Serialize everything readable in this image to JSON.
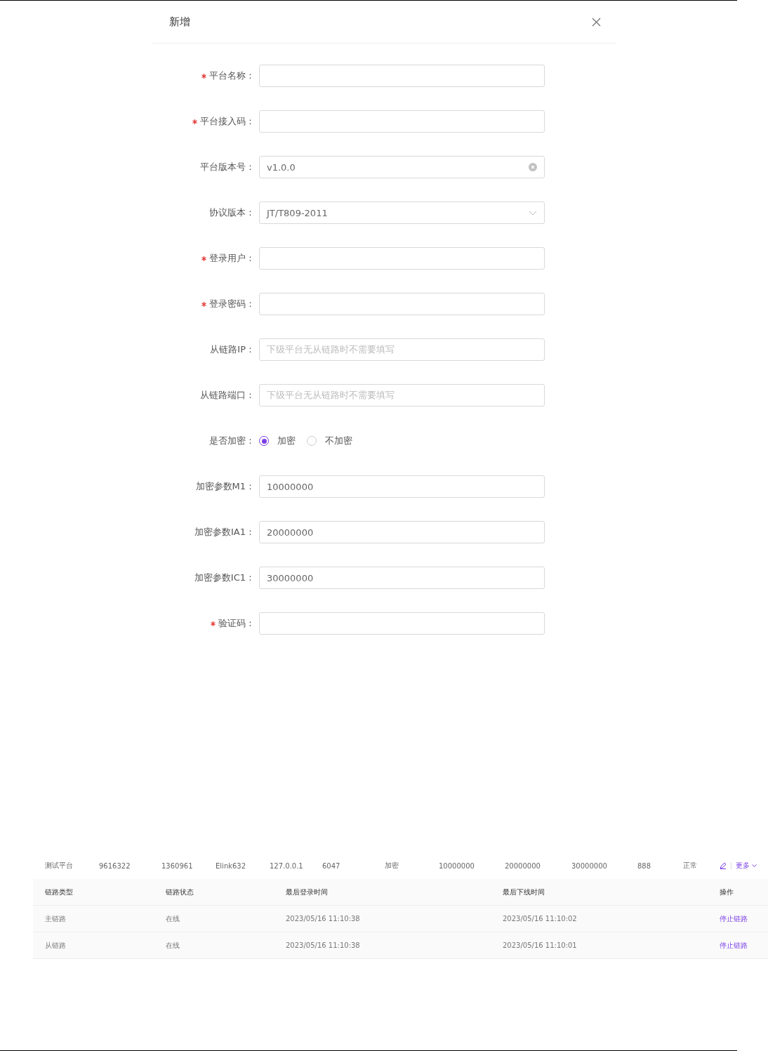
{
  "dialog": {
    "title": "新增",
    "fields": [
      {
        "kind": "input",
        "label": "平台名称：",
        "required": true
      },
      {
        "kind": "input",
        "label": "平台接入码：",
        "required": true
      },
      {
        "kind": "input",
        "label": "平台版本号：",
        "required": false,
        "value": "v1.0.0",
        "clearable": true
      },
      {
        "kind": "select",
        "label": "协议版本：",
        "required": false,
        "value": "JT/T809-2011"
      },
      {
        "kind": "input",
        "label": "登录用户：",
        "required": true
      },
      {
        "kind": "input",
        "label": "登录密码：",
        "required": true
      },
      {
        "kind": "input",
        "label": "从链路IP：",
        "required": false,
        "placeholder": "下级平台无从链路时不需要填写"
      },
      {
        "kind": "input",
        "label": "从链路端口：",
        "required": false,
        "placeholder": "下级平台无从链路时不需要填写"
      },
      {
        "kind": "radio",
        "label": "是否加密：",
        "required": false,
        "options": [
          {
            "label": "加密",
            "selected": true
          },
          {
            "label": "不加密",
            "selected": false
          }
        ]
      },
      {
        "kind": "input",
        "label": "加密参数M1：",
        "required": false,
        "value": "10000000"
      },
      {
        "kind": "input",
        "label": "加密参数IA1：",
        "required": false,
        "value": "20000000"
      },
      {
        "kind": "input",
        "label": "加密参数IC1：",
        "required": false,
        "value": "30000000"
      },
      {
        "kind": "input",
        "label": "验证码：",
        "required": true
      }
    ]
  },
  "platform_row": {
    "cells": [
      "测试平台",
      "9616322",
      "1360961",
      "Elink632",
      "127.0.0.1",
      "6047",
      "加密",
      "10000000",
      "20000000",
      "30000000",
      "888",
      "正常"
    ],
    "more": "更多"
  },
  "link_table": {
    "columns": [
      "链路类型",
      "链路状态",
      "最后登录时间",
      "最后下线时间",
      "操作"
    ],
    "rows": [
      {
        "cells": [
          "主链路",
          "在线",
          "2023/05/16 11:10:38",
          "2023/05/16 11:10:02"
        ],
        "action": "停止链路"
      },
      {
        "cells": [
          "从链路",
          "在线",
          "2023/05/16 11:10:38",
          "2023/05/16 11:10:01"
        ],
        "action": "停止链路"
      }
    ]
  }
}
